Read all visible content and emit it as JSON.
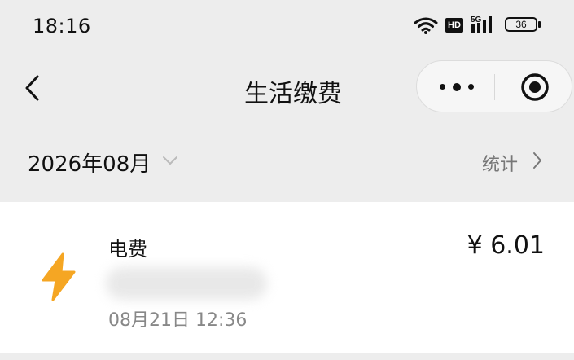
{
  "status_bar": {
    "time": "18:16",
    "network_badge": "HD",
    "network_type": "5G",
    "battery_level": "36"
  },
  "nav": {
    "title": "生活缴费"
  },
  "filter": {
    "month": "2026年08月",
    "stats_label": "统计"
  },
  "record": {
    "name": "电费",
    "amount": "¥ 6.01",
    "time": "08月21日 12:36",
    "icon": "lightning-icon",
    "icon_color": "#f5a623"
  }
}
